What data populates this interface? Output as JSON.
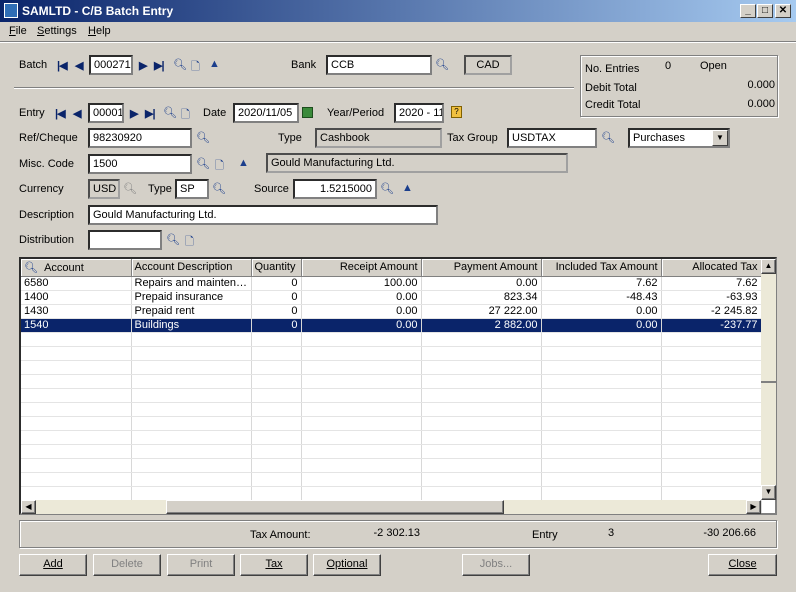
{
  "window": {
    "title": "SAMLTD - C/B Batch Entry",
    "min": "_",
    "max": "□",
    "close": "✕"
  },
  "menu": [
    {
      "accel": "F",
      "rest": "ile"
    },
    {
      "accel": "S",
      "rest": "ettings"
    },
    {
      "accel": "H",
      "rest": "elp"
    }
  ],
  "batch": {
    "label": "Batch",
    "number": "000271",
    "bank_label": "Bank",
    "bank": "CCB",
    "currency_code": "CAD"
  },
  "summary": {
    "entries_label": "No. Entries",
    "entries": "0",
    "status": "Open",
    "debit_label": "Debit Total",
    "debit": "0.000",
    "credit_label": "Credit Total",
    "credit": "0.000"
  },
  "entry": {
    "label": "Entry",
    "number": "00001",
    "date_label": "Date",
    "date": "2020/11/05",
    "yp_label": "Year/Period",
    "year_period": "2020 - 11",
    "ref_label": "Ref/Cheque",
    "ref": "98230920",
    "type_label": "Type",
    "type": "Cashbook",
    "taxgroup_label": "Tax Group",
    "taxgroup": "USDTAX",
    "taxclass": "Purchases",
    "misc_label": "Misc. Code",
    "misc": "1500",
    "misc_desc": "Gould Manufacturing Ltd.",
    "currency_label": "Currency",
    "currency": "USD",
    "ratetype_label": "Type",
    "ratetype": "SP",
    "source_label": "Source",
    "source": "1.5215000",
    "desc_label": "Description",
    "description": "Gould Manufacturing Ltd.",
    "dist_label": "Distribution",
    "distribution": ""
  },
  "table": {
    "headers": [
      "Account",
      "Account Description",
      "Quantity",
      "Receipt Amount",
      "Payment Amount",
      "Included Tax Amount",
      "Allocated Tax"
    ],
    "rows": [
      [
        "6580",
        "Repairs and mainten…",
        "0",
        "100.00",
        "0.00",
        "7.62",
        "7.62"
      ],
      [
        "1400",
        "Prepaid insurance",
        "0",
        "0.00",
        "823.34",
        "-48.43",
        "-63.93"
      ],
      [
        "1430",
        "Prepaid rent",
        "0",
        "0.00",
        "27 222.00",
        "0.00",
        "-2 245.82"
      ],
      [
        "1540",
        "Buildings",
        "0",
        "0.00",
        "2 882.00",
        "0.00",
        "-237.77"
      ]
    ],
    "selected_row": 3
  },
  "footer": {
    "tax_label": "Tax Amount:",
    "tax": "-2 302.13",
    "entry_label": "Entry",
    "entry_no": "3",
    "entry_total": "-30 206.66"
  },
  "buttons": {
    "add": "Add",
    "delete": "Delete",
    "print": "Print",
    "tax": "Tax",
    "optional": "Optional",
    "jobs": "Jobs...",
    "close": "Close"
  },
  "colors": {
    "title_start": "#0a246a",
    "title_end": "#a6caf0",
    "selection": "#0a246a",
    "face": "#d4d0c8"
  }
}
